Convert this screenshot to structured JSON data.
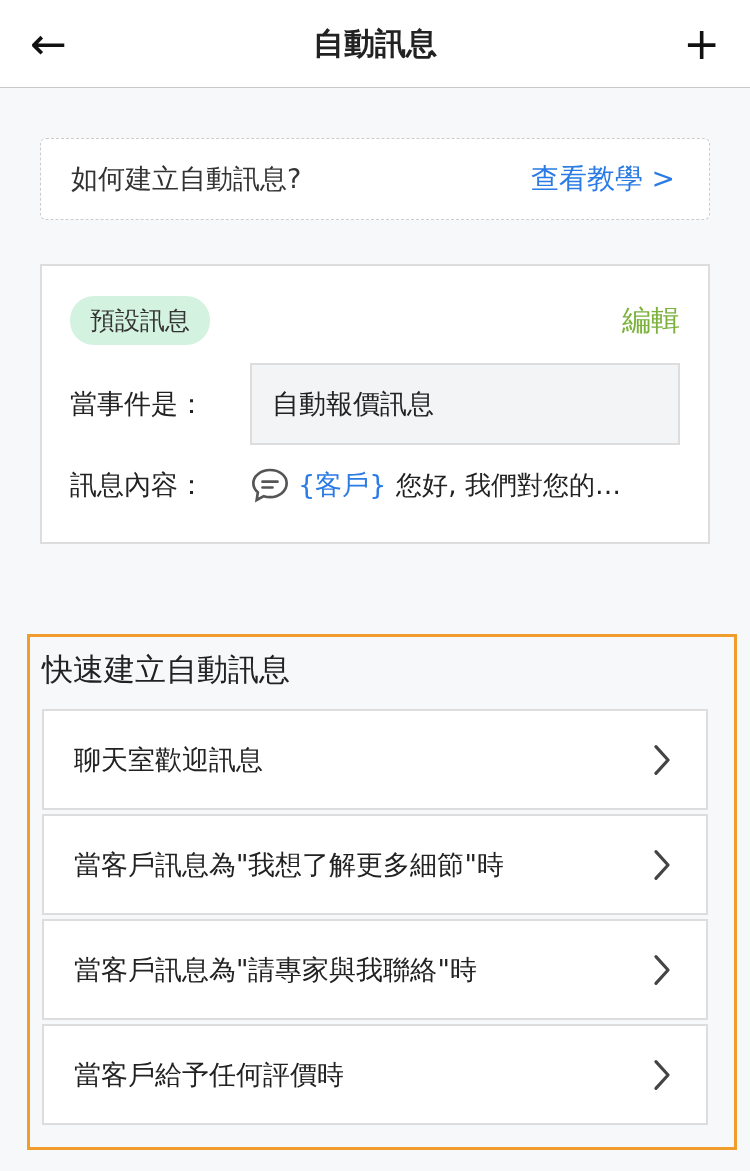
{
  "header": {
    "back": "←",
    "title": "自動訊息",
    "add": "+"
  },
  "tutorial": {
    "question": "如何建立自動訊息?",
    "link": "查看教學 >"
  },
  "default_card": {
    "tag": "預設訊息",
    "edit": "編輯",
    "event_label": "當事件是：",
    "event_value": "自動報價訊息",
    "content_label": "訊息內容：",
    "content_variable": "{客戶}",
    "content_text": "您好, 我們對您的…"
  },
  "quick_create": {
    "title": "快速建立自動訊息",
    "highlighted": true,
    "items": [
      {
        "label": "聊天室歡迎訊息"
      },
      {
        "label": "當客戶訊息為\"我想了解更多細節\"時"
      },
      {
        "label": "當客戶訊息為\"請專家與我聯絡\"時"
      },
      {
        "label": "當客戶給予任何評價時"
      }
    ]
  }
}
